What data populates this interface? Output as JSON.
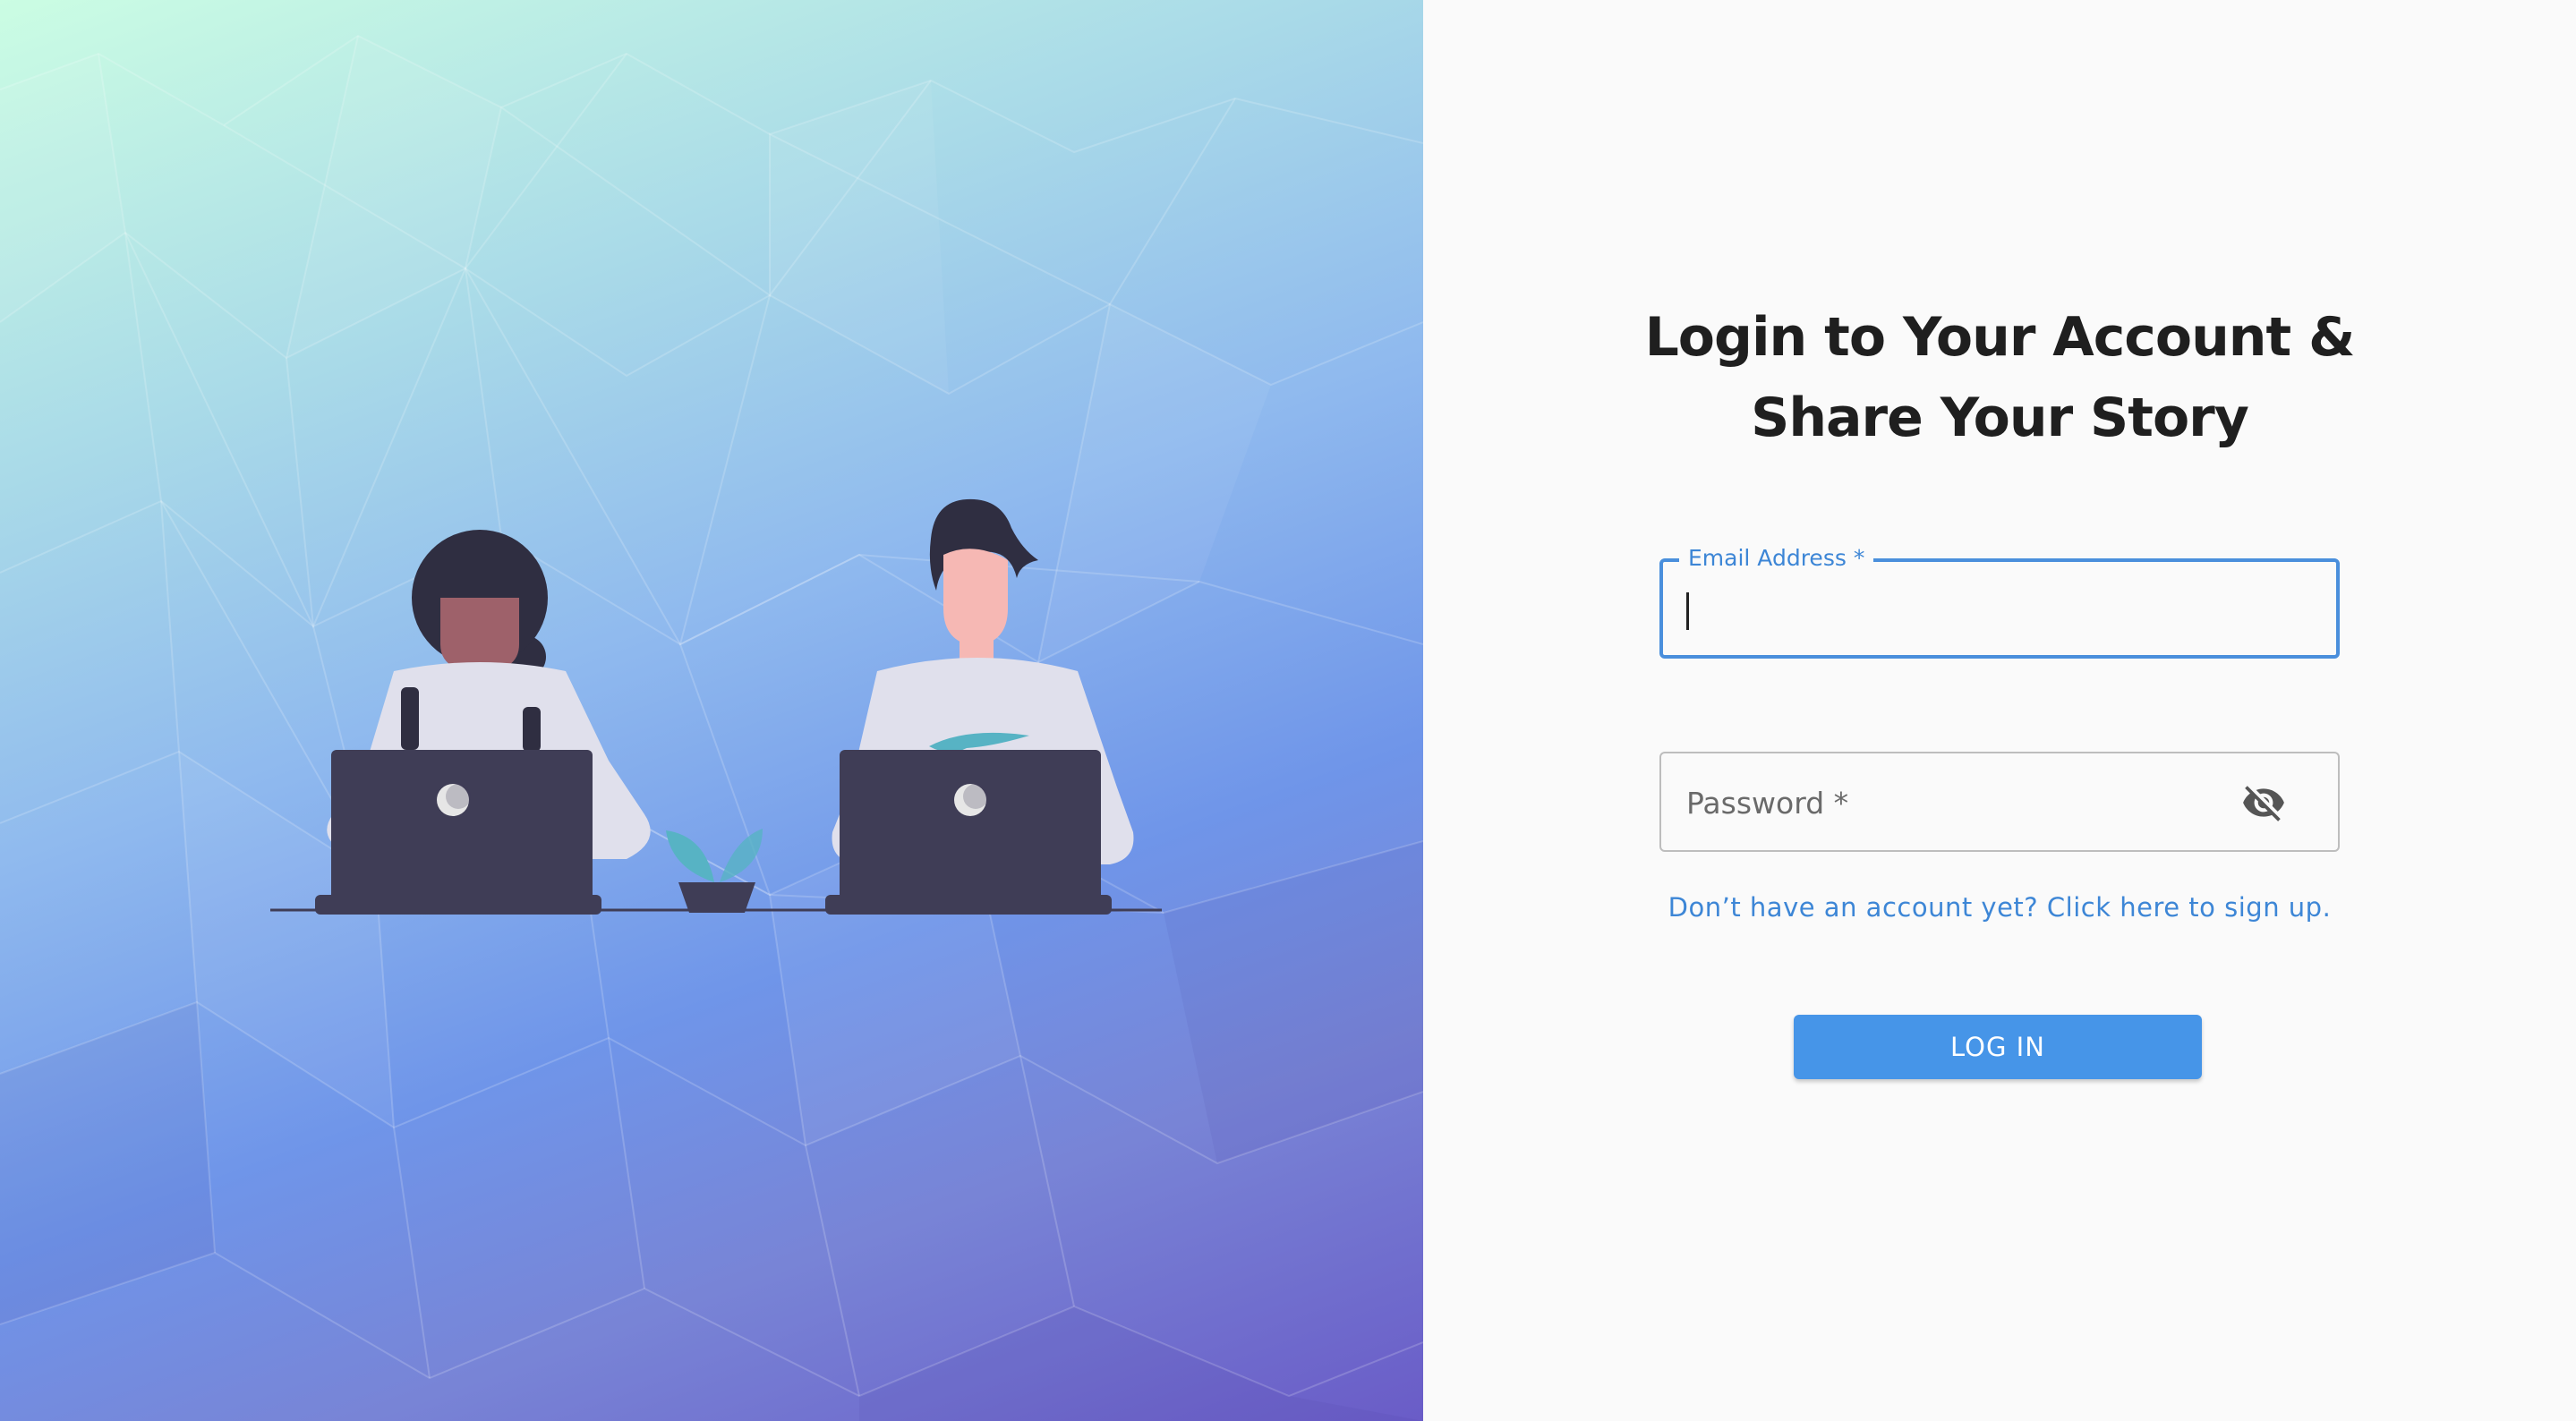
{
  "left_panel": {
    "illustration": "two-people-working-on-laptops",
    "colors": {
      "gradient_top": "#cbfde3",
      "gradient_mid": "#8fb9ee",
      "gradient_bottom": "#6a5cc7",
      "laptop": "#3f3d56",
      "shirt": "#e0e0ec",
      "plant": "#57b3c4"
    }
  },
  "login_form": {
    "heading_line1": "Login to Your Account &",
    "heading_line2": "Share Your Story",
    "email": {
      "label": "Email Address *",
      "value": "",
      "focused": true
    },
    "password": {
      "label": "Password *",
      "value": "",
      "visibility_icon": "eye-off-icon"
    },
    "signup_link": "Don’t have an account yet? Click here to sign up.",
    "login_button": "LOG IN"
  },
  "colors": {
    "accent": "#4695e8",
    "link": "#3d86d6",
    "heading": "#1f1f1f",
    "background": "#fafafa"
  }
}
